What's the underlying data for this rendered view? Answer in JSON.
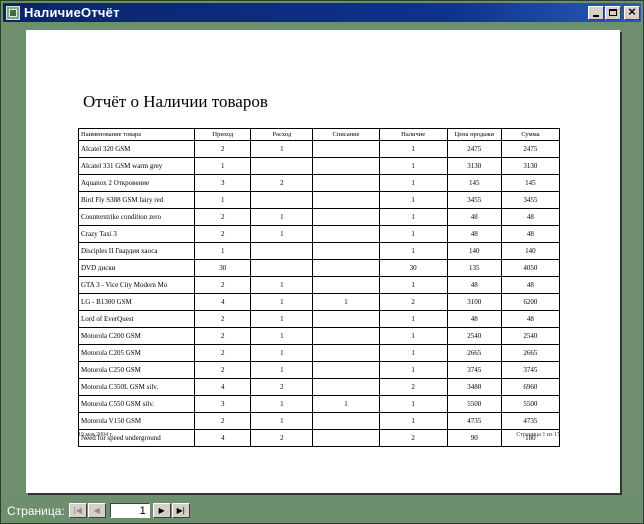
{
  "window": {
    "title": "НаличиеОтчёт"
  },
  "report": {
    "title": "Отчёт о Наличии товаров",
    "columns": [
      "Наименование товара",
      "Приход",
      "Расход",
      "Списание",
      "Наличие",
      "Цена продажи",
      "Сумма"
    ],
    "rows": [
      [
        "Alcatel 320 GSM",
        "2",
        "1",
        "",
        "1",
        "2475",
        "2475"
      ],
      [
        "Alcatel 331 GSM warm grey",
        "1",
        "",
        "",
        "1",
        "3130",
        "3130"
      ],
      [
        "Aquanox 2 Откровение",
        "3",
        "2",
        "",
        "1",
        "145",
        "145"
      ],
      [
        "Bird Fly S388 GSM fairy red",
        "1",
        "",
        "",
        "1",
        "3455",
        "3455"
      ],
      [
        "Counterstrike condition zero",
        "2",
        "1",
        "",
        "1",
        "48",
        "48"
      ],
      [
        "Crazy Taxi 3",
        "2",
        "1",
        "",
        "1",
        "48",
        "48"
      ],
      [
        "Disciples II Гвардия хаоса",
        "1",
        "",
        "",
        "1",
        "140",
        "140"
      ],
      [
        "DVD диски",
        "30",
        "",
        "",
        "30",
        "135",
        "4050"
      ],
      [
        "GTA 3 - Vice City Modern Mo",
        "2",
        "1",
        "",
        "1",
        "48",
        "48"
      ],
      [
        "LG - B1300 GSM",
        "4",
        "1",
        "1",
        "2",
        "3100",
        "6200"
      ],
      [
        "Lord of EverQuest",
        "2",
        "1",
        "",
        "1",
        "48",
        "48"
      ],
      [
        "Motorola C200 GSM",
        "2",
        "1",
        "",
        "1",
        "2540",
        "2540"
      ],
      [
        "Motorola C205 GSM",
        "2",
        "1",
        "",
        "1",
        "2665",
        "2665"
      ],
      [
        "Motorola C250 GSM",
        "2",
        "1",
        "",
        "1",
        "3745",
        "3745"
      ],
      [
        "Motorola C350L GSM silv.",
        "4",
        "2",
        "",
        "2",
        "3480",
        "6960"
      ],
      [
        "Motorola C550 GSM silv.",
        "3",
        "1",
        "1",
        "1",
        "5500",
        "5500"
      ],
      [
        "Motorola V150 GSM",
        "2",
        "1",
        "",
        "1",
        "4735",
        "4735"
      ],
      [
        "Need for speed underground",
        "4",
        "2",
        "",
        "2",
        "90",
        "180"
      ]
    ],
    "footer_date": "19 мая 2004 г.",
    "footer_page": "Страница 1 из 17"
  },
  "navigation": {
    "label": "Страница:",
    "current_page": "1"
  }
}
